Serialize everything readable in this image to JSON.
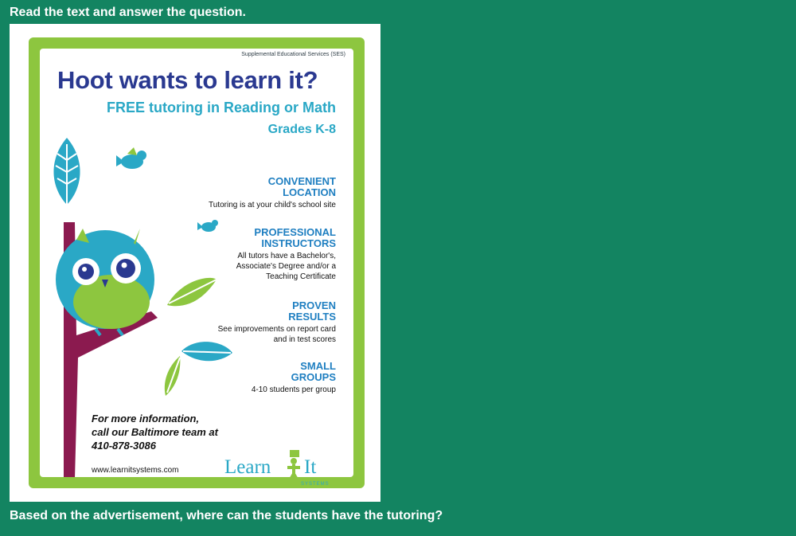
{
  "prompt": "Read the text and answer the question.",
  "question": "Based on the advertisement, where can the students have the tutoring?",
  "flyer": {
    "ses_label": "Supplemental Educational Services (SES)",
    "headline": "Hoot wants to learn it?",
    "subhead": "FREE tutoring in Reading or Math",
    "grades": "Grades K-8",
    "features": [
      {
        "title": "CONVENIENT\nLOCATION",
        "desc": "Tutoring is at your child's school site"
      },
      {
        "title": "PROFESSIONAL\nINSTRUCTORS",
        "desc": "All tutors have a Bachelor's,\nAssociate's Degree and/or a\nTeaching Certificate"
      },
      {
        "title": "PROVEN\nRESULTS",
        "desc": "See improvements on report card\nand in test scores"
      },
      {
        "title": "SMALL\nGROUPS",
        "desc": "4-10 students per group"
      }
    ],
    "contact": "For more information,\ncall our Baltimore team at\n410-878-3086",
    "url": "www.learnitsystems.com",
    "logo": {
      "learn": "Learn",
      "it": "It",
      "systems": "SYSTEMS"
    }
  },
  "colors": {
    "background": "#138461",
    "border_green": "#8dc63f",
    "headline_blue": "#2a3990",
    "teal": "#2aa8c6",
    "feature_blue": "#1f7fc1",
    "branch": "#8b1a4f"
  },
  "icons": [
    "owl-illustration",
    "bird-icon",
    "leaf-icon"
  ]
}
